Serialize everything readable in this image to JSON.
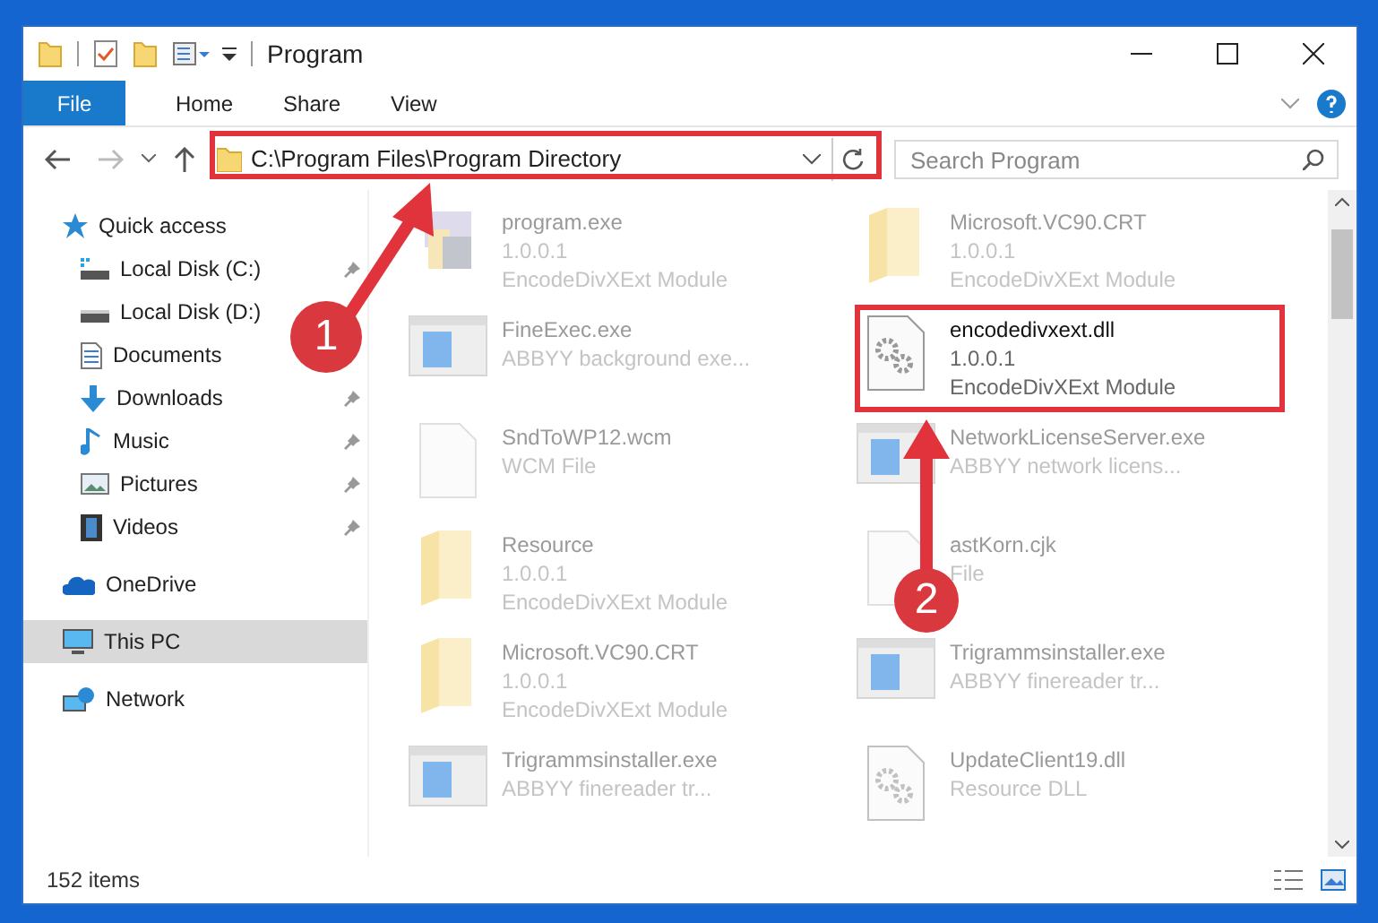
{
  "window": {
    "title": "Program"
  },
  "ribbon_tabs": [
    {
      "label": "File",
      "kind": "file-menu",
      "selected": false
    },
    {
      "label": "Home",
      "kind": "tab",
      "selected": false
    },
    {
      "label": "Share",
      "kind": "tab",
      "selected": false
    },
    {
      "label": "View",
      "kind": "tab",
      "selected": false
    }
  ],
  "address_bar": {
    "path": "C:\\Program Files\\Program Directory",
    "highlighted": true
  },
  "search": {
    "placeholder": "Search Program"
  },
  "navigation": [
    {
      "label": "Quick access",
      "kind": "star",
      "selected": false,
      "children": [
        {
          "label": "Local Disk (C:)",
          "kind": "drive-c",
          "pinned": true,
          "selected": false
        },
        {
          "label": "Local Disk (D:)",
          "kind": "drive",
          "pinned": false,
          "selected": false
        },
        {
          "label": "Documents",
          "kind": "documents",
          "pinned": false,
          "selected": false
        },
        {
          "label": "Downloads",
          "kind": "downloads",
          "pinned": true,
          "selected": false
        },
        {
          "label": "Music",
          "kind": "music",
          "pinned": true,
          "selected": false
        },
        {
          "label": "Pictures",
          "kind": "pictures",
          "pinned": true,
          "selected": false
        },
        {
          "label": "Videos",
          "kind": "videos",
          "pinned": true,
          "selected": false
        }
      ]
    },
    {
      "label": "OneDrive",
      "kind": "onedrive",
      "selected": false
    },
    {
      "label": "This PC",
      "kind": "pc",
      "selected": true
    },
    {
      "label": "Network",
      "kind": "network",
      "selected": false
    }
  ],
  "files": [
    {
      "kind": "exe-app",
      "lines": [
        "program.exe",
        "1.0.0.1",
        "EncodeDivXExt Module"
      ],
      "highlighted": false
    },
    {
      "kind": "folder",
      "lines": [
        "Microsoft.VC90.CRT",
        "1.0.0.1",
        "EncodeDivXExt Module"
      ],
      "highlighted": false
    },
    {
      "kind": "window-app",
      "lines": [
        "FineExec.exe",
        "ABBYY background exe..."
      ],
      "highlighted": false
    },
    {
      "kind": "dll",
      "lines": [
        "encodedivxext.dll",
        "1.0.0.1",
        "EncodeDivXExt Module"
      ],
      "highlighted": true
    },
    {
      "kind": "blank-file",
      "lines": [
        "SndToWP12.wcm",
        "WCM File"
      ],
      "highlighted": false
    },
    {
      "kind": "window-app",
      "lines": [
        "NetworkLicenseServer.exe",
        "ABBYY network licens..."
      ],
      "highlighted": false
    },
    {
      "kind": "folder",
      "lines": [
        "Resource",
        "1.0.0.1",
        "EncodeDivXExt Module"
      ],
      "highlighted": false
    },
    {
      "kind": "blank-file",
      "lines": [
        "astKorn.cjk",
        "File"
      ],
      "highlighted": false
    },
    {
      "kind": "folder",
      "lines": [
        "Microsoft.VC90.CRT",
        "1.0.0.1",
        "EncodeDivXExt Module"
      ],
      "highlighted": false
    },
    {
      "kind": "window-app",
      "lines": [
        "Trigrammsinstaller.exe",
        "ABBYY finereader tr..."
      ],
      "highlighted": false
    },
    {
      "kind": "window-app",
      "lines": [
        "Trigrammsinstaller.exe",
        "ABBYY finereader tr..."
      ],
      "highlighted": false
    },
    {
      "kind": "dll",
      "lines": [
        "UpdateClient19.dll",
        "Resource DLL"
      ],
      "highlighted": false
    }
  ],
  "status_bar": {
    "item_count": "152 items"
  },
  "step_badges": [
    "1",
    "2"
  ]
}
